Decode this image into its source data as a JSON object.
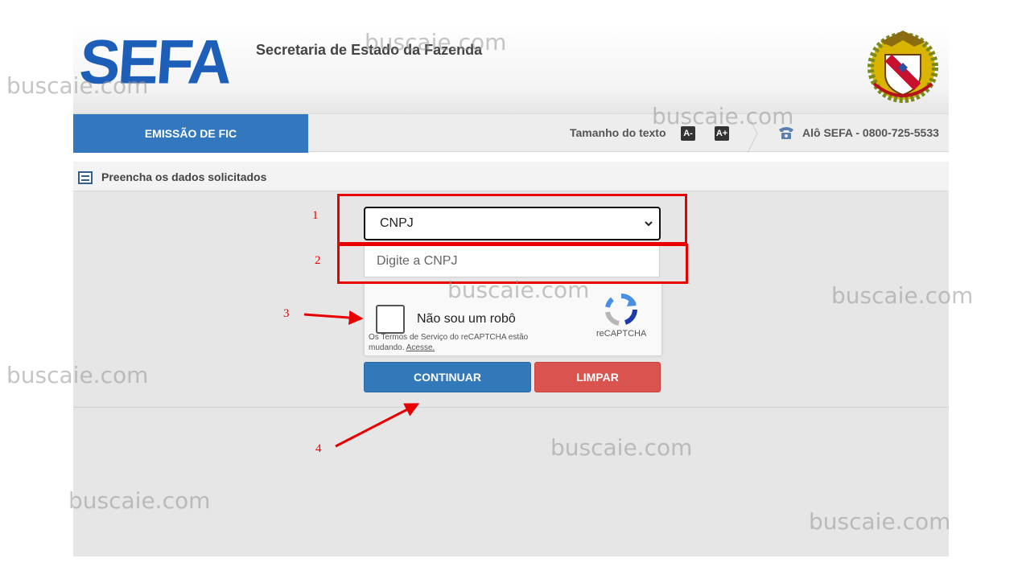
{
  "header": {
    "logo_text": "SEFA",
    "department": "Secretaria de Estado da Fazenda"
  },
  "nav": {
    "active_tab": "EMISSÃO DE FIC",
    "text_size_label": "Tamanho do texto",
    "decrease_font": "A-",
    "increase_font": "A+",
    "phone_label": "Alô SEFA - 0800-725-5533"
  },
  "form": {
    "section_title": "Preencha os dados solicitados",
    "doc_type_selected": "CNPJ",
    "doc_input_placeholder": "Digite a CNPJ",
    "captcha": {
      "label": "Não sou um robô",
      "brand": "reCAPTCHA",
      "terms_text": "Os Termos de Serviço do reCAPTCHA estão mudando.",
      "terms_link": "Acesse."
    },
    "continue_label": "CONTINUAR",
    "clear_label": "LIMPAR"
  },
  "annotations": {
    "step1": "1",
    "step2": "2",
    "step3": "3",
    "step4": "4",
    "color": "#e60000"
  },
  "watermark": "buscaie.com",
  "colors": {
    "brand_blue": "#1d5fb8",
    "primary_button": "#3379b9",
    "danger_button": "#d9534f"
  }
}
